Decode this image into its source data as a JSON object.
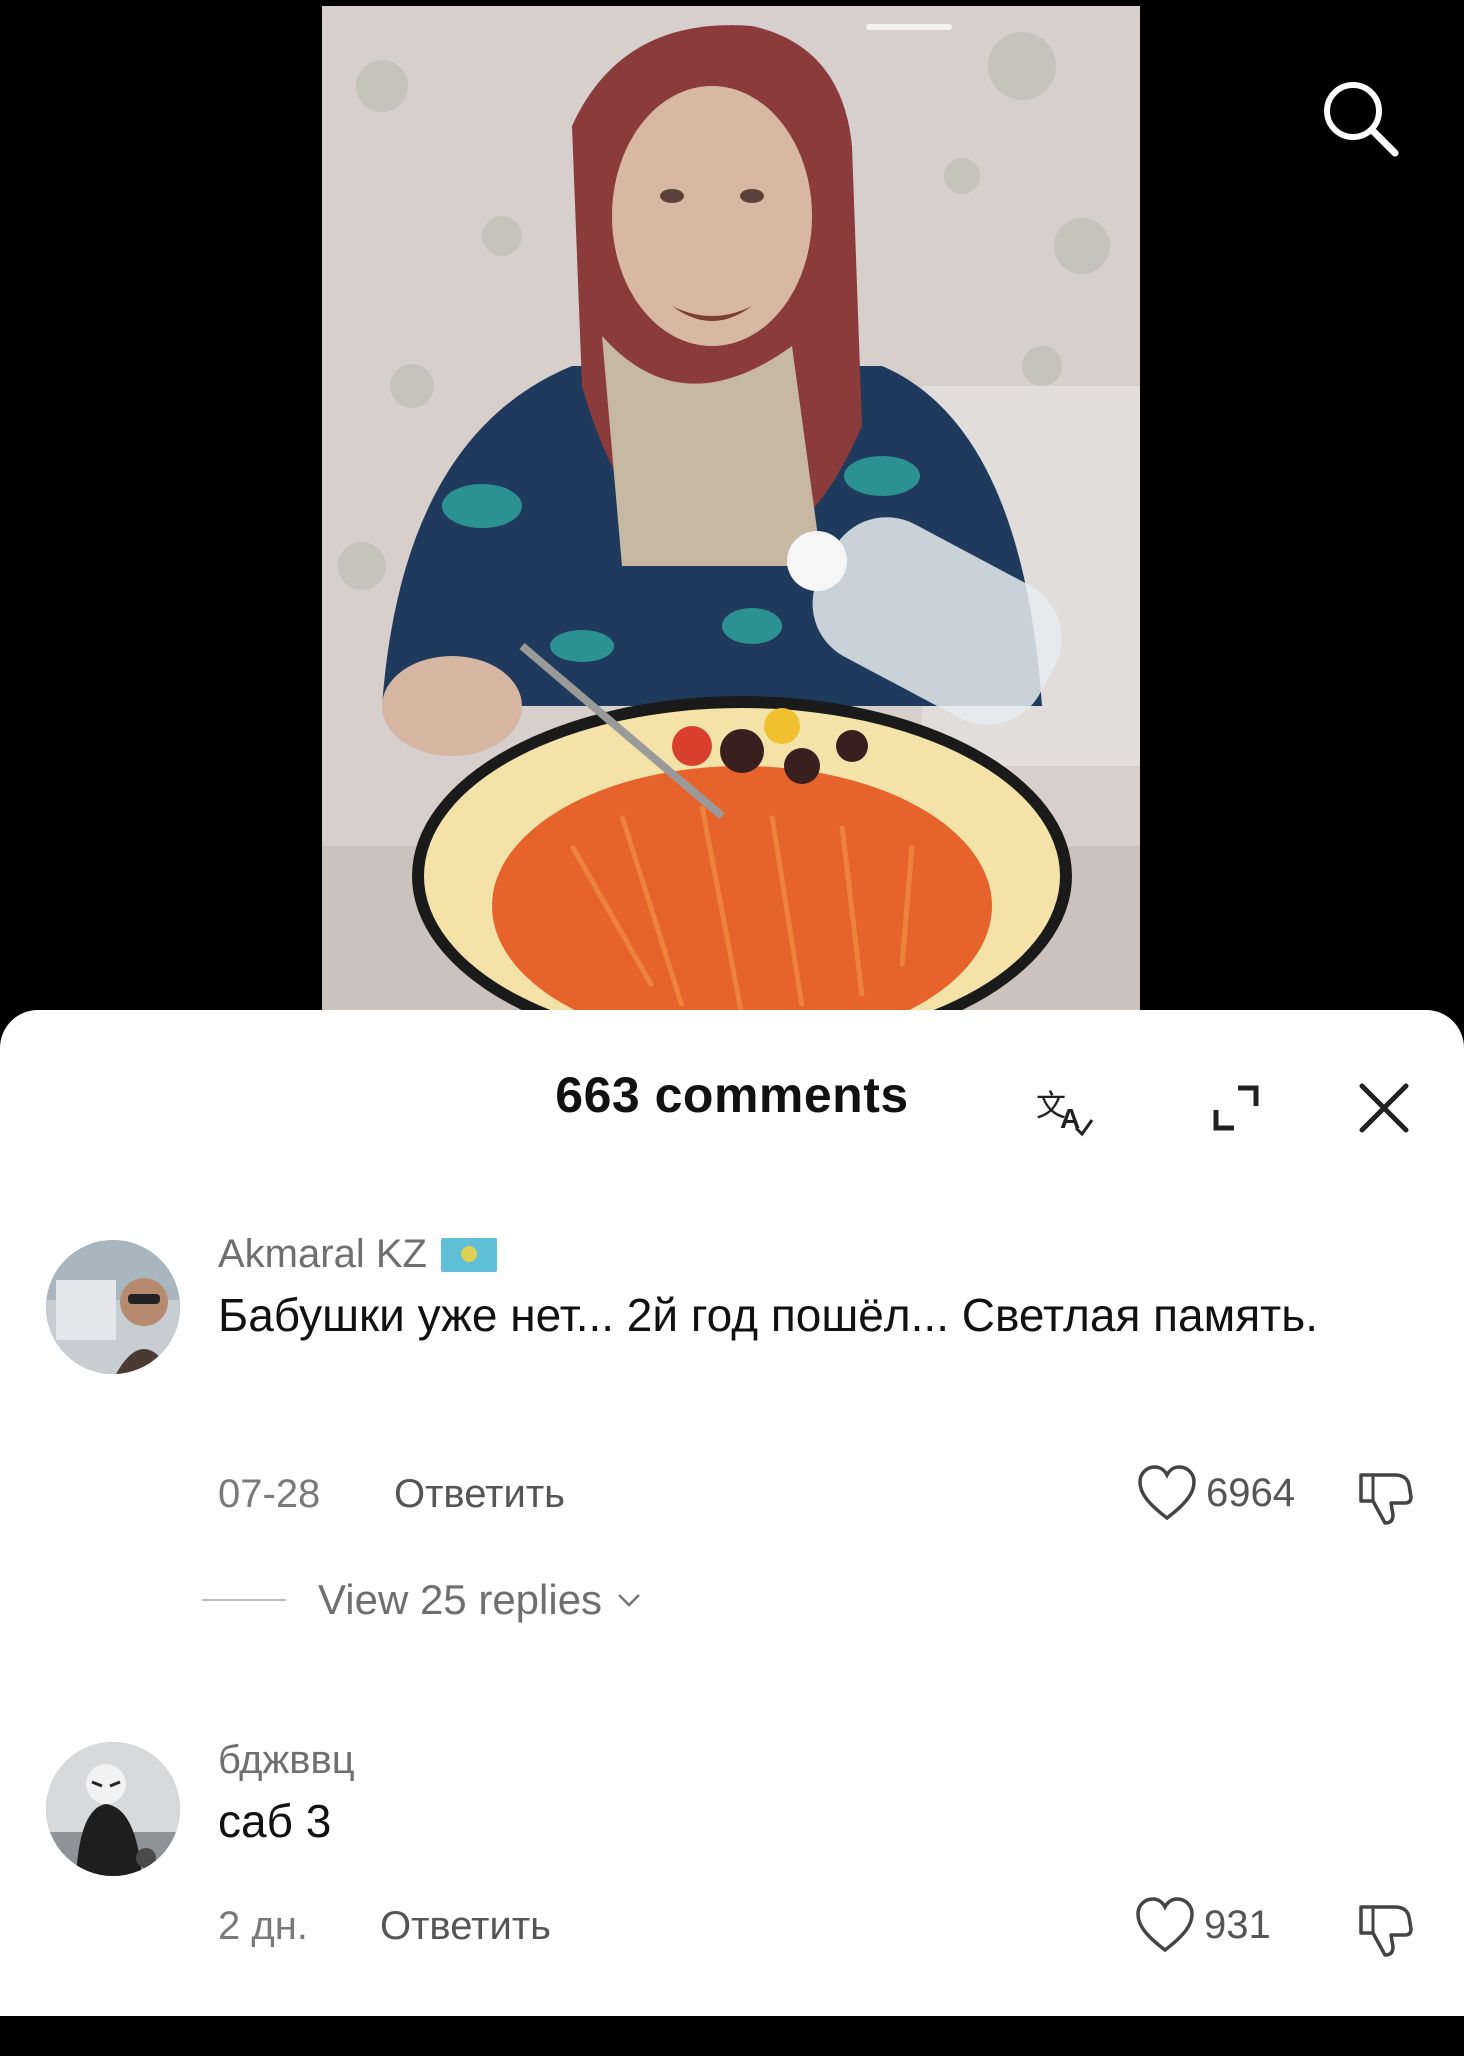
{
  "video": {
    "description_icon": "search-icon"
  },
  "comments_header": {
    "count_label": "663 comments",
    "translate_icon": "translate-icon",
    "expand_icon": "expand-icon",
    "close_icon": "close-icon"
  },
  "comments": [
    {
      "username": "Akmaral KZ",
      "flag": "kazakhstan-flag",
      "text": "Бабушки уже нет... 2й год пошёл... Светлая память.",
      "date": "07-28",
      "reply_label": "Ответить",
      "likes": "6964",
      "replies_label": "View 25 replies"
    },
    {
      "username": "бджввц",
      "text": "саб 3",
      "date": "2 дн.",
      "reply_label": "Ответить",
      "likes": "931"
    }
  ],
  "colors": {
    "sheet_bg": "#ffffff",
    "background": "#000000",
    "text_primary": "#111111",
    "text_secondary": "#6f6f6f"
  }
}
